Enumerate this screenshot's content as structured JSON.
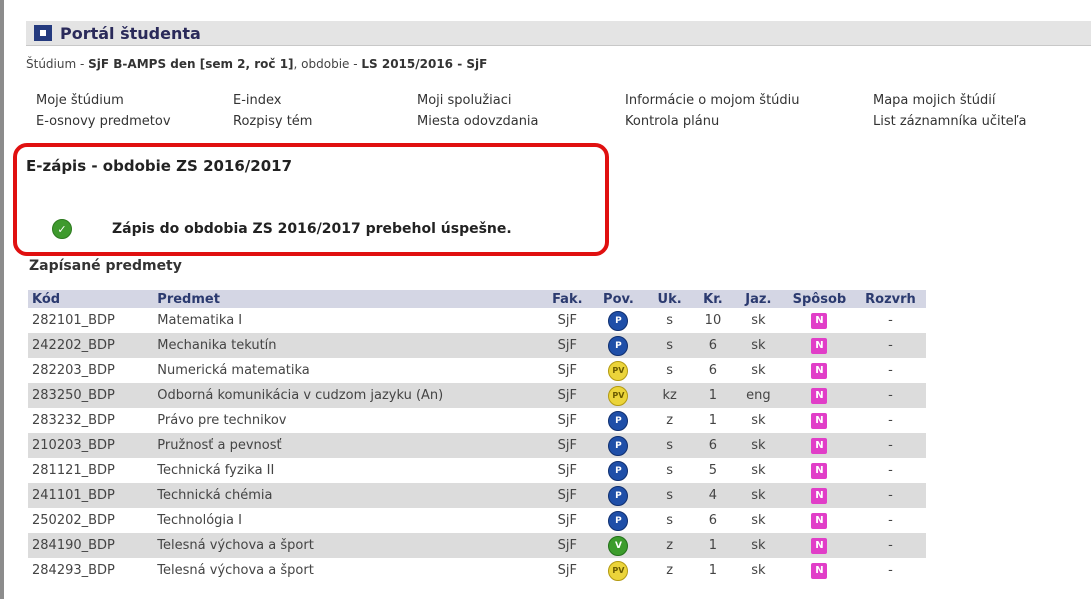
{
  "header": {
    "title": "Portál študenta"
  },
  "breadcrumb": {
    "label1": "Štúdium",
    "dash1": " - ",
    "study": "SjF B-AMPS den [sem 2, roč 1]",
    "label2": ", obdobie - ",
    "period": "LS 2015/2016 - SjF"
  },
  "nav": [
    {
      "label": "Moje štúdium"
    },
    {
      "label": "E-index"
    },
    {
      "label": "Moji spolužiaci"
    },
    {
      "label": "Informácie o mojom štúdiu"
    },
    {
      "label": "Mapa mojich štúdií"
    },
    {
      "label": "E-osnovy predmetov"
    },
    {
      "label": "Rozpisy tém"
    },
    {
      "label": "Miesta odovzdania"
    },
    {
      "label": "Kontrola plánu"
    },
    {
      "label": "List záznamníka učiteľa"
    }
  ],
  "ezapis": {
    "title": "E-zápis - obdobie ZS 2016/2017",
    "message": "Zápis do obdobia ZS 2016/2017 prebehol úspešne."
  },
  "courses": {
    "section_title": "Zapísané predmety",
    "columns": [
      "Kód",
      "Predmet",
      "Fak.",
      "Pov.",
      "Uk.",
      "Kr.",
      "Jaz.",
      "Spôsob",
      "Rozvrh"
    ],
    "rows": [
      {
        "kod": "282101_BDP",
        "predmet": "Matematika I",
        "fak": "SjF",
        "pov": "P",
        "uk": "s",
        "kr": "10",
        "jaz": "sk",
        "sposob": "N",
        "rozvrh": "-"
      },
      {
        "kod": "242202_BDP",
        "predmet": "Mechanika tekutín",
        "fak": "SjF",
        "pov": "P",
        "uk": "s",
        "kr": "6",
        "jaz": "sk",
        "sposob": "N",
        "rozvrh": "-"
      },
      {
        "kod": "282203_BDP",
        "predmet": "Numerická matematika",
        "fak": "SjF",
        "pov": "PV",
        "uk": "s",
        "kr": "6",
        "jaz": "sk",
        "sposob": "N",
        "rozvrh": "-"
      },
      {
        "kod": "283250_BDP",
        "predmet": "Odborná komunikácia v cudzom jazyku (An)",
        "fak": "SjF",
        "pov": "PV",
        "uk": "kz",
        "kr": "1",
        "jaz": "eng",
        "sposob": "N",
        "rozvrh": "-"
      },
      {
        "kod": "283232_BDP",
        "predmet": "Právo pre technikov",
        "fak": "SjF",
        "pov": "P",
        "uk": "z",
        "kr": "1",
        "jaz": "sk",
        "sposob": "N",
        "rozvrh": "-"
      },
      {
        "kod": "210203_BDP",
        "predmet": "Pružnosť a pevnosť",
        "fak": "SjF",
        "pov": "P",
        "uk": "s",
        "kr": "6",
        "jaz": "sk",
        "sposob": "N",
        "rozvrh": "-"
      },
      {
        "kod": "281121_BDP",
        "predmet": "Technická fyzika II",
        "fak": "SjF",
        "pov": "P",
        "uk": "s",
        "kr": "5",
        "jaz": "sk",
        "sposob": "N",
        "rozvrh": "-"
      },
      {
        "kod": "241101_BDP",
        "predmet": "Technická chémia",
        "fak": "SjF",
        "pov": "P",
        "uk": "s",
        "kr": "4",
        "jaz": "sk",
        "sposob": "N",
        "rozvrh": "-"
      },
      {
        "kod": "250202_BDP",
        "predmet": "Technológia I",
        "fak": "SjF",
        "pov": "P",
        "uk": "s",
        "kr": "6",
        "jaz": "sk",
        "sposob": "N",
        "rozvrh": "-"
      },
      {
        "kod": "284190_BDP",
        "predmet": "Telesná výchova a šport",
        "fak": "SjF",
        "pov": "V",
        "uk": "z",
        "kr": "1",
        "jaz": "sk",
        "sposob": "N",
        "rozvrh": "-"
      },
      {
        "kod": "284293_BDP",
        "predmet": "Telesná výchova a šport",
        "fak": "SjF",
        "pov": "PV",
        "uk": "z",
        "kr": "1",
        "jaz": "sk",
        "sposob": "N",
        "rozvrh": "-"
      }
    ]
  },
  "icons": {
    "header": "portal-square-icon",
    "success": "success-check-icon",
    "pov": "pov-badge-icon",
    "sposob": "sposob-badge-icon"
  },
  "colors": {
    "highlight_box": "#e01010",
    "pov_P": "#1f4fa8",
    "pov_PV": "#ebd43a",
    "pov_V": "#3c9c2c",
    "sposob_badge": "#e13ec8"
  }
}
